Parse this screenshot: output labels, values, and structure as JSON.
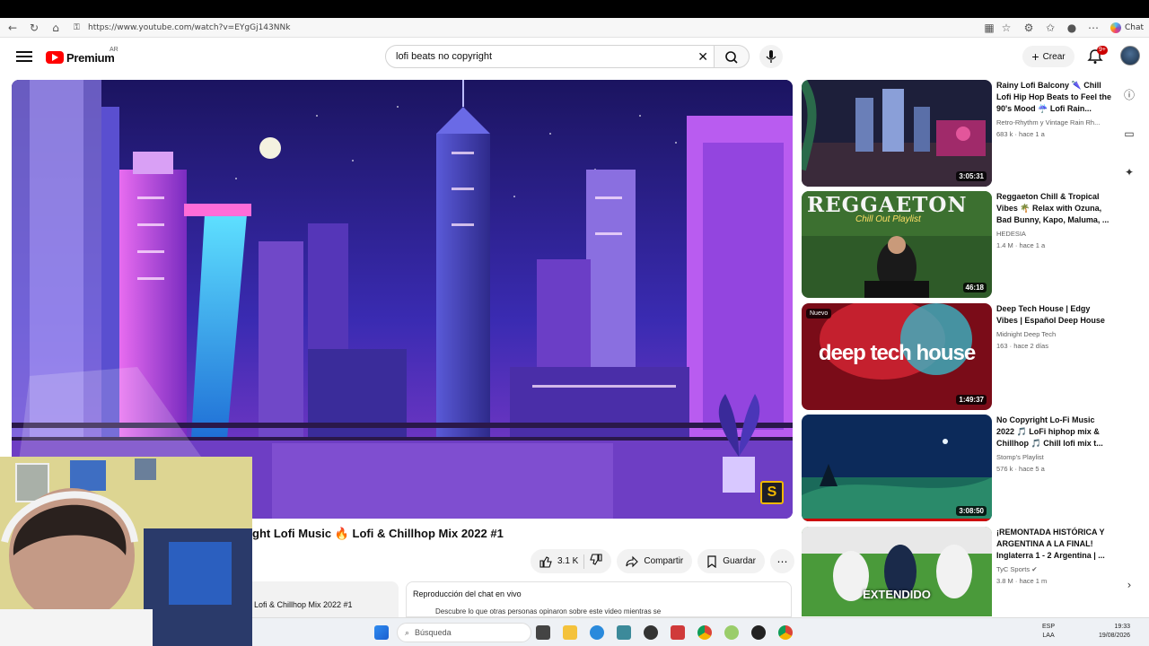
{
  "browser": {
    "url": "https://www.youtube.com/watch?v=EYgGj143NNk",
    "chat_label": "Chat"
  },
  "header": {
    "logo_text": "Premium",
    "region_code": "AR",
    "search_value": "lofi beats no copyright",
    "create_label": "Crear",
    "notification_count": "9+"
  },
  "video": {
    "title": "ght Lofi Music 🔥 Lofi & Chillhop Mix 2022 #1",
    "likes": "3.1 K",
    "share_label": "Compartir",
    "save_label": "Guardar",
    "watermark": "S"
  },
  "description_snippet": "Lofi & Chillhop Mix 2022 #1",
  "chat": {
    "title": "Reproducción del chat en vivo",
    "subtitle": "Descubre lo que otras personas opinaron sobre este video mientras se"
  },
  "recommendations": [
    {
      "title": "Rainy Lofi Balcony 🌂 Chill Lofi Hip Hop Beats to Feel the 90's Mood ☔ Lofi Rain...",
      "channel": "Retro-Rhythm y Vintage Rain Rh...",
      "views": "683 k",
      "age": "hace 1 a",
      "duration": "3:05:31",
      "badge": ""
    },
    {
      "title": "Reggaeton Chill & Tropical Vibes 🌴 Relax with Ozuna, Bad Bunny, Kapo, Maluma, ...",
      "channel": "HEDESIA",
      "views": "1.4 M",
      "age": "hace 1 a",
      "duration": "46:18",
      "badge": "",
      "thumb_text": "REGGAETON",
      "thumb_sub": "Chill Out Playlist"
    },
    {
      "title": "Deep Tech House | Edgy Vibes | Español Deep House",
      "channel": "Midnight Deep Tech",
      "views": "163",
      "age": "hace 2 días",
      "duration": "1:49:37",
      "badge": "Nuevo",
      "thumb_text": "deep tech house"
    },
    {
      "title": "No Copyright Lo-Fi Music 2022 🎵 LoFi hiphop mix & Chillhop 🎵 Chill lofi mix t...",
      "channel": "Stomp's Playlist",
      "views": "576 k",
      "age": "hace 5 a",
      "duration": "3:08:50",
      "badge": ""
    },
    {
      "title": "¡REMONTADA HISTÓRICA Y ARGENTINA A LA FINAL! Inglaterra 1 - 2 Argentina | ...",
      "channel": "TyC Sports",
      "views": "3.8 M",
      "age": "hace 1 m",
      "duration": "",
      "badge": "",
      "thumb_text": "EXTENDIDO"
    }
  ],
  "taskbar": {
    "search_placeholder": "Búsqueda",
    "lang_top": "ESP",
    "lang_bottom": "LAA",
    "time": "19:33",
    "date": "19/08/2026"
  }
}
